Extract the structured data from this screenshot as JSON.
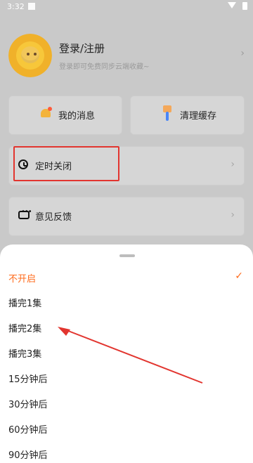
{
  "status_bar": {
    "time": "3:32"
  },
  "profile": {
    "title": "登录/注册",
    "subtitle": "登录即可免费同步云端收藏~"
  },
  "tiles": {
    "messages": "我的消息",
    "clear_cache": "清理缓存",
    "timer": "定时关闭",
    "feedback": "意见反馈"
  },
  "sleep_timer_sheet": {
    "options": [
      "不开启",
      "播完1集",
      "播完2集",
      "播完3集",
      "15分钟后",
      "30分钟后",
      "60分钟后",
      "90分钟后"
    ],
    "selected_index": 0,
    "accent": "#ff6a1a"
  },
  "annotation": {
    "highlight_color": "#e2352f"
  }
}
